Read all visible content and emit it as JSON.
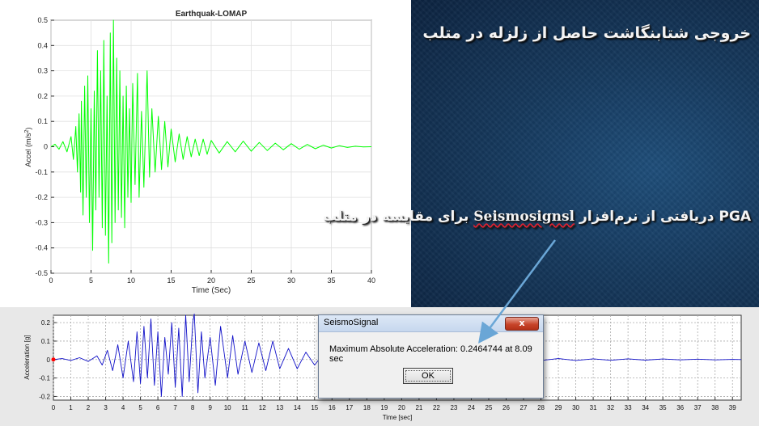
{
  "colors": {
    "matlab_trace": "#00ff00",
    "seismo_trace": "#1010c8",
    "panel_dark": "#16395d",
    "arrow": "#6aa6d6",
    "peak_marker": "#ff0000"
  },
  "headings": {
    "line1": "خروجی شتابنگاشت حاصل از زلزله در متلب",
    "line2_prefix": "PGA دریافتی از نرم‌افزار",
    "line2_software": "Seismosignsl",
    "line2_suffix": "برای مقایسه در متلب"
  },
  "dialog": {
    "title": "SeismoSignal",
    "close_label": "x",
    "message": "Maximum Absolute Acceleration: 0.2464744 at 8.09 sec",
    "ok_label": "OK"
  },
  "chart_data": [
    {
      "type": "line",
      "title": "Earthquak-LOMAP",
      "xlabel": "Time (Sec)",
      "ylabel": "Accel (m/s",
      "ylabel_sup": "2",
      "ylabel_end": ")",
      "xlim": [
        0,
        40
      ],
      "ylim": [
        -0.5,
        0.5
      ],
      "xticks": [
        0,
        5,
        10,
        15,
        20,
        25,
        30,
        35,
        40
      ],
      "xtick_labels": [
        "0",
        "5",
        "10",
        "15",
        "20",
        "25",
        "30",
        "35",
        "40"
      ],
      "yticks": [
        -0.5,
        -0.4,
        -0.3,
        -0.2,
        -0.1,
        0,
        0.1,
        0.2,
        0.3,
        0.4,
        0.5
      ],
      "ytick_labels": [
        "-0.5",
        "-0.4",
        "-0.3",
        "-0.2",
        "-0.1",
        "0",
        "0.1",
        "0.2",
        "0.3",
        "0.4",
        "0.5"
      ],
      "grid": true,
      "series": [
        {
          "x": [
            0,
            0.5,
            1,
            1.5,
            2,
            2.5,
            2.8,
            3.1,
            3.3,
            3.5,
            3.7,
            3.8,
            4,
            4.2,
            4.4,
            4.6,
            4.8,
            5,
            5.2,
            5.4,
            5.6,
            5.8,
            6,
            6.2,
            6.4,
            6.6,
            6.8,
            7,
            7.2,
            7.4,
            7.6,
            7.8,
            8,
            8.2,
            8.4,
            8.6,
            8.8,
            9,
            9.2,
            9.4,
            9.6,
            9.8,
            10,
            10.2,
            10.5,
            10.8,
            11,
            11.3,
            11.6,
            12,
            12.3,
            12.6,
            13,
            13.4,
            13.8,
            14.2,
            14.6,
            15,
            15.5,
            16,
            16.5,
            17,
            17.5,
            18,
            18.5,
            19,
            19.5,
            20,
            21,
            22,
            23,
            24,
            25,
            26,
            27,
            28,
            29,
            30,
            31,
            32,
            33,
            34,
            35,
            36,
            37,
            38,
            39,
            40
          ],
          "y": [
            0,
            0.01,
            -0.01,
            0.02,
            -0.02,
            0.04,
            -0.05,
            0.08,
            -0.1,
            0.13,
            -0.18,
            0.18,
            -0.27,
            0.24,
            -0.2,
            0.28,
            -0.3,
            0.15,
            -0.41,
            0.22,
            -0.25,
            0.38,
            -0.2,
            0.3,
            -0.32,
            0.42,
            -0.35,
            0.2,
            -0.46,
            0.45,
            -0.38,
            0.5,
            -0.3,
            0.35,
            -0.25,
            0.3,
            -0.28,
            0.2,
            -0.32,
            0.24,
            -0.2,
            0.15,
            -0.22,
            0.25,
            -0.15,
            0.29,
            -0.2,
            0.14,
            -0.16,
            0.3,
            -0.12,
            0.15,
            -0.1,
            0.12,
            -0.09,
            0.1,
            -0.08,
            0.07,
            -0.06,
            0.05,
            -0.05,
            0.04,
            -0.04,
            0.03,
            -0.035,
            0.03,
            -0.03,
            0.025,
            -0.025,
            0.02,
            -0.02,
            0.022,
            -0.018,
            0.017,
            -0.015,
            0.014,
            -0.012,
            0.012,
            -0.01,
            0.009,
            -0.008,
            0.006,
            -0.005,
            0.004,
            -0.003,
            0.002,
            -0.001,
            0
          ]
        }
      ]
    },
    {
      "type": "line",
      "xlabel": "Time [sec]",
      "ylabel": "Acceleration [g]",
      "xlim": [
        0,
        39.5
      ],
      "ylim": [
        -0.22,
        0.24
      ],
      "xticks": [
        0,
        1,
        2,
        3,
        4,
        5,
        6,
        7,
        8,
        9,
        10,
        11,
        12,
        13,
        14,
        15,
        16,
        17,
        18,
        19,
        20,
        21,
        22,
        23,
        24,
        25,
        26,
        27,
        28,
        29,
        30,
        31,
        32,
        33,
        34,
        35,
        36,
        37,
        38,
        39
      ],
      "xtick_labels": [
        "0",
        "1",
        "2",
        "3",
        "4",
        "5",
        "6",
        "7",
        "8",
        "9",
        "10",
        "11",
        "12",
        "13",
        "14",
        "15",
        "16",
        "17",
        "18",
        "19",
        "20",
        "21",
        "22",
        "23",
        "24",
        "25",
        "26",
        "27",
        "28",
        "29",
        "30",
        "31",
        "32",
        "33",
        "34",
        "35",
        "36",
        "37",
        "38",
        "39"
      ],
      "yticks": [
        -0.2,
        -0.1,
        0,
        0.1,
        0.2
      ],
      "ytick_labels": [
        "-0.2",
        "-0.1",
        "0",
        "0.1",
        "0.2"
      ],
      "grid": true,
      "series": [
        {
          "x": [
            0,
            0.5,
            1,
            1.5,
            2,
            2.5,
            2.8,
            3.1,
            3.4,
            3.7,
            4,
            4.3,
            4.6,
            4.8,
            5,
            5.2,
            5.4,
            5.6,
            5.8,
            6,
            6.2,
            6.4,
            6.6,
            6.8,
            7,
            7.2,
            7.4,
            7.6,
            7.8,
            8,
            8.09,
            8.3,
            8.5,
            8.7,
            9,
            9.3,
            9.6,
            10,
            10.3,
            10.6,
            11,
            11.4,
            11.8,
            12.2,
            12.6,
            13,
            13.5,
            14,
            14.5,
            15,
            15.5,
            16,
            17,
            18,
            19,
            20,
            21,
            22,
            23,
            24,
            25,
            26,
            27,
            28,
            29,
            30,
            31,
            32,
            33,
            34,
            35,
            36,
            37,
            38,
            39,
            39.5
          ],
          "y": [
            0,
            0.005,
            -0.005,
            0.01,
            -0.01,
            0.02,
            -0.03,
            0.05,
            -0.06,
            0.08,
            -0.1,
            0.1,
            -0.12,
            0.15,
            -0.13,
            0.18,
            -0.1,
            0.22,
            -0.14,
            0.15,
            -0.2,
            0.12,
            -0.08,
            0.2,
            -0.15,
            0.17,
            -0.2,
            0.24,
            -0.12,
            0.2,
            0.2465,
            -0.18,
            0.15,
            -0.1,
            0.12,
            -0.14,
            0.18,
            -0.1,
            0.13,
            -0.08,
            0.1,
            -0.07,
            0.09,
            -0.06,
            0.1,
            -0.05,
            0.06,
            -0.05,
            0.04,
            -0.03,
            0.03,
            -0.02,
            0.02,
            -0.015,
            0.012,
            -0.01,
            0.01,
            -0.009,
            0.008,
            -0.007,
            0.007,
            -0.006,
            0.006,
            -0.005,
            0.005,
            -0.005,
            0.004,
            -0.004,
            0.004,
            -0.003,
            0.003,
            -0.002,
            0.002,
            -0.002,
            0.001,
            0
          ]
        }
      ]
    }
  ]
}
